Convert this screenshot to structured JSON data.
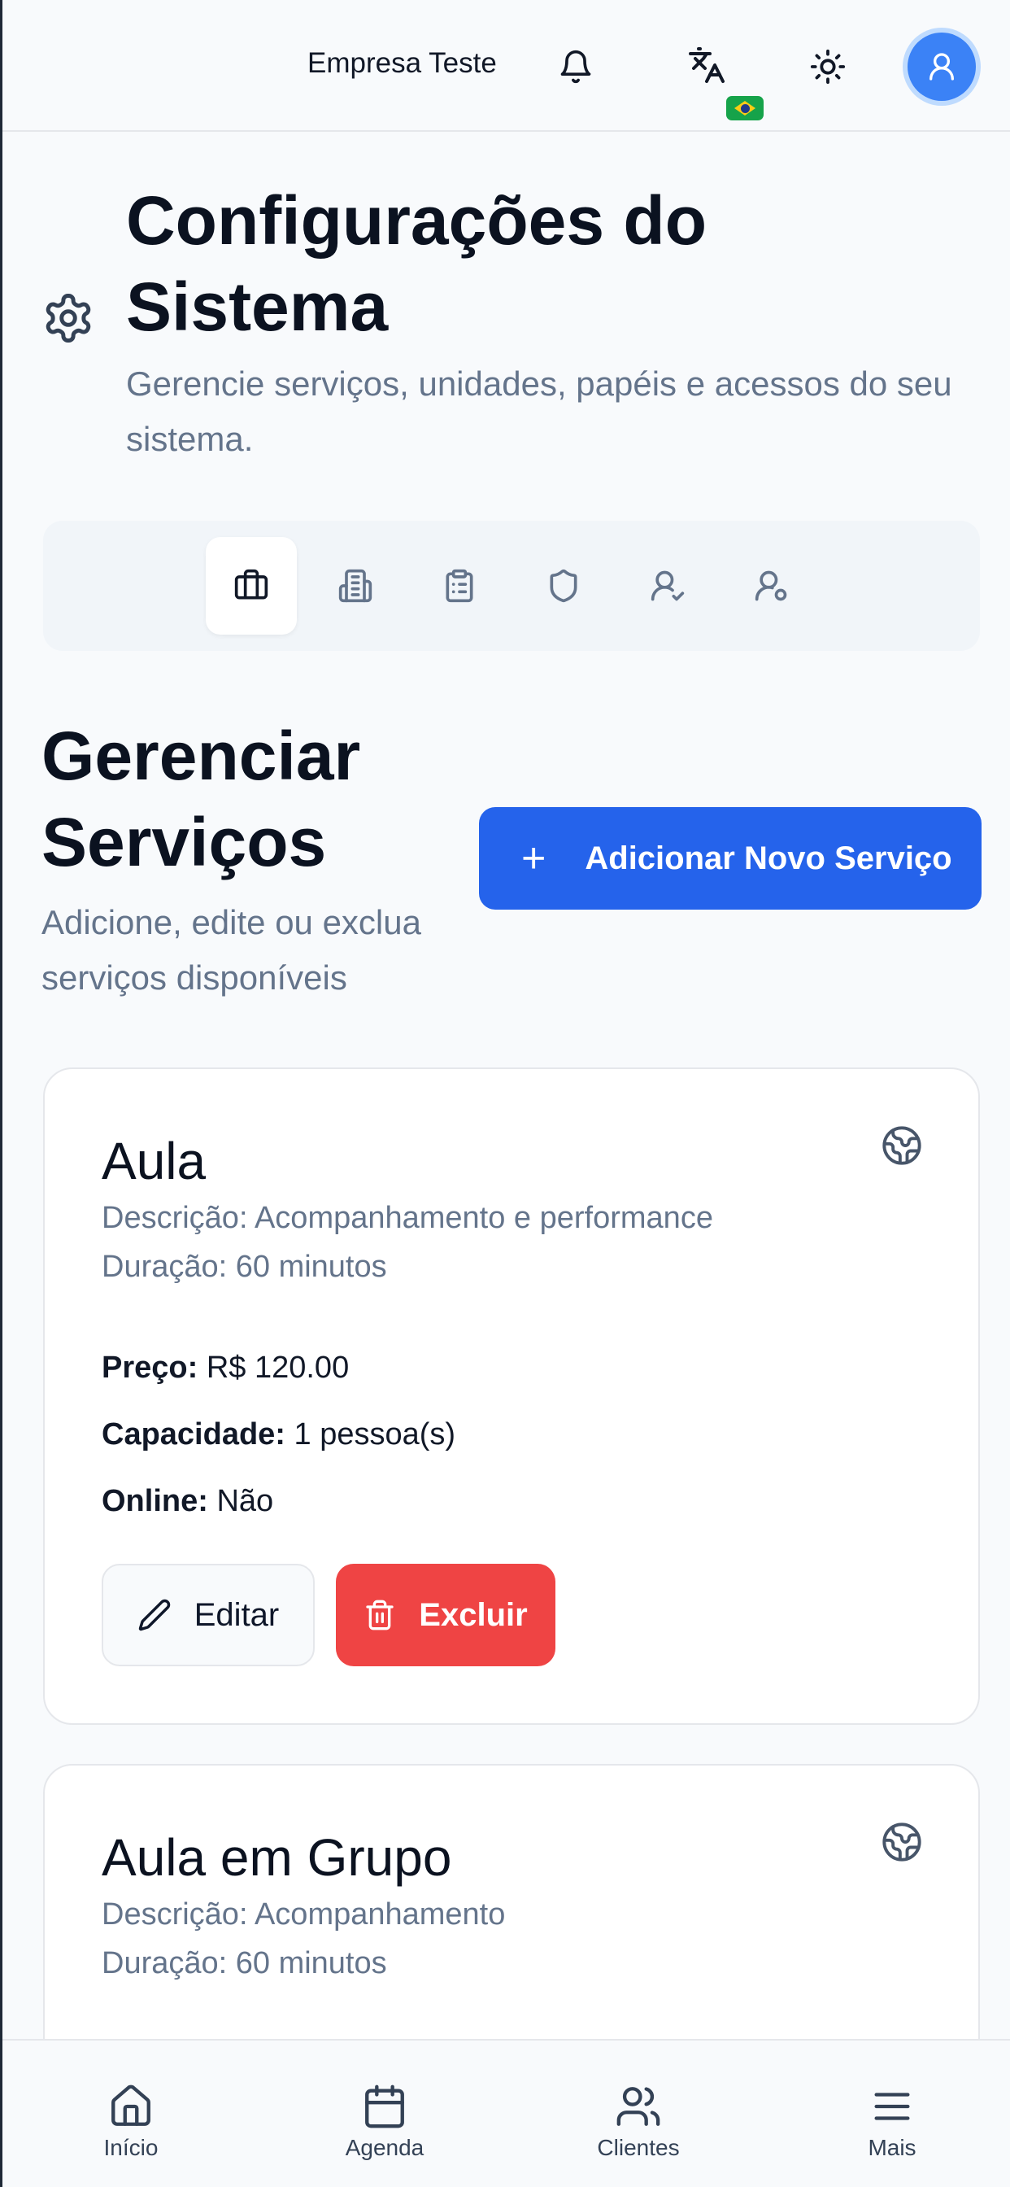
{
  "header": {
    "company": "Empresa Teste"
  },
  "page": {
    "title": "Configurações do Sistema",
    "subtitle": "Gerencie serviços, unidades, papéis e acessos do seu sistema."
  },
  "tabs": [
    {
      "icon": "briefcase-icon",
      "active": true
    },
    {
      "icon": "building-icon",
      "active": false
    },
    {
      "icon": "clipboard-icon",
      "active": false
    },
    {
      "icon": "shield-icon",
      "active": false
    },
    {
      "icon": "user-check-icon",
      "active": false
    },
    {
      "icon": "user-settings-icon",
      "active": false
    }
  ],
  "section": {
    "title": "Gerenciar Serviços",
    "subtitle": "Adicione, edite ou exclua serviços disponíveis",
    "add_button": "Adicionar Novo Serviço"
  },
  "services": [
    {
      "name": "Aula",
      "description": "Descrição: Acompanhamento e performance",
      "duration": "Duração: 60 minutos",
      "price_label": "Preço:",
      "price_value": "R$ 120.00",
      "capacity_label": "Capacidade:",
      "capacity_value": "1 pessoa(s)",
      "online_label": "Online:",
      "online_value": "Não",
      "edit_label": "Editar",
      "delete_label": "Excluir"
    },
    {
      "name": "Aula em Grupo",
      "description": "Descrição: Acompanhamento",
      "duration": "Duração: 60 minutos"
    }
  ],
  "nav": {
    "home": "Início",
    "schedule": "Agenda",
    "clients": "Clientes",
    "more": "Mais"
  },
  "colors": {
    "primary": "#2563eb",
    "danger": "#ef4444",
    "muted_text": "#64748b"
  }
}
